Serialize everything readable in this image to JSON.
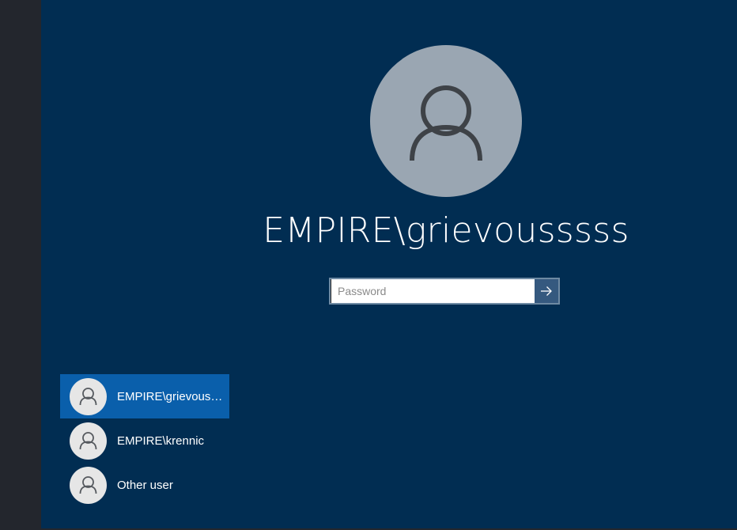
{
  "account": {
    "display_name": "EMPIRE\\grievousssss",
    "avatar_icon": "user-silhouette-icon"
  },
  "password": {
    "value": "",
    "placeholder": "Password",
    "submit_icon": "arrow-right-icon"
  },
  "user_list": [
    {
      "label": "EMPIRE\\grievousssss",
      "selected": true
    },
    {
      "label": "EMPIRE\\krennic",
      "selected": false
    },
    {
      "label": "Other user",
      "selected": false
    }
  ],
  "colors": {
    "background": "#012d52",
    "selected_item": "#0a5fab",
    "avatar_large": "#9aa6b2",
    "avatar_small": "#e6e6e6",
    "submit_button": "#35597f"
  }
}
